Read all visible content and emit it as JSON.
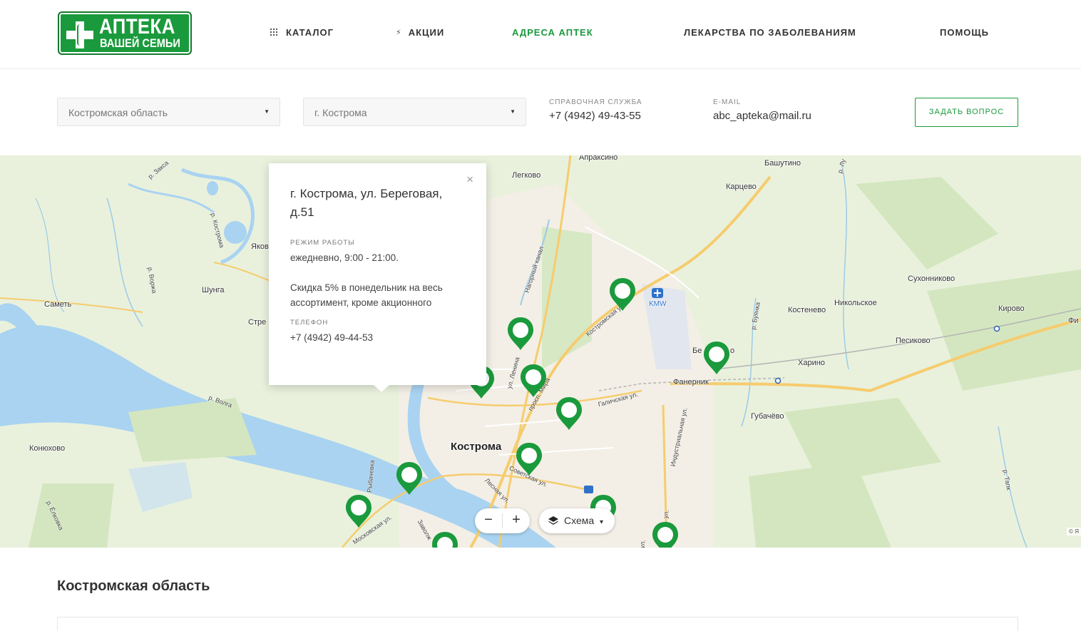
{
  "logo": {
    "line1": "АПТЕКА",
    "line2": "ВАШЕЙ СЕМЬИ",
    "brand_color": "#1a9a3c"
  },
  "nav": {
    "catalog": "КАТАЛОГ",
    "promo": "АКЦИИ",
    "addresses": "АДРЕСА АПТЕК",
    "diseases": "ЛЕКАРСТВА ПО ЗАБОЛЕВАНИЯМ",
    "help": "ПОМОЩЬ"
  },
  "filters": {
    "region": "Костромская область",
    "city": "г. Кострома"
  },
  "contacts": {
    "phone_label": "СПРАВОЧНАЯ СЛУЖБА",
    "phone": "+7 (4942) 49-43-55",
    "email_label": "E-MAIL",
    "email": "abc_apteka@mail.ru",
    "ask_button": "ЗАДАТЬ ВОПРОС"
  },
  "map": {
    "places": {
      "apraksino": "Апраксино",
      "bashutino": "Башутино",
      "legkovo": "Легково",
      "kartsevo": "Карцево",
      "yakov": "Яков",
      "shunga": "Шунга",
      "sametj": "Саметь",
      "stre": "Стре",
      "sukonnikovo": "Сухонниково",
      "kostenevo": "Костенево",
      "nikolskoe": "Никольское",
      "kirovo": "Кирово",
      "fi": "Фи",
      "pesikovo": "Песиково",
      "kharino": "Харино",
      "be": "Бе",
      "ro": "о",
      "fanernik": "Фанерник",
      "gubachevo": "Губачёво",
      "konyukhovo": "Конюхово",
      "kostroma": "Кострома",
      "kmw": "KMW"
    },
    "streets": {
      "zaksa": "р. Закса",
      "kostroma_r": "р. Кострома",
      "vorzha": "р. Воржа",
      "volga": "р. Волга",
      "nagorny": "Нагорный канал",
      "kostromskaya": "Костромская ул.",
      "lenina": "ул. Ленина",
      "mira": "просп. Мира",
      "galichskaya": "Галичская ул.",
      "industrialnaya": "Индустриальная ул.",
      "buyanka": "р. Буянка",
      "sovetskaya": "Советская ул.",
      "lesnaya": "Лесная ул.",
      "moskovskaya": "Московская ул.",
      "zavolzh": "Заволж",
      "elkovka": "р. Ёлковка",
      "lucha": "р. Лу",
      "tapk": "р. Тапк",
      "ul": "ул.",
      "ul2": "ул.",
      "ryb": "Рыбачевка"
    },
    "popup": {
      "address": "г. Кострома, ул. Береговая, д.51",
      "hours_label": "РЕЖИМ РАБОТЫ",
      "hours": "ежедневно, 9:00 - 21:00.",
      "note": "Скидка 5% в понедельник на весь ассортимент, кроме акционного",
      "phone_label": "ТЕЛЕФОН",
      "phone": "+7 (4942) 49-44-53",
      "close": "×"
    },
    "zoom_out": "−",
    "zoom_in": "+",
    "layer_label": "Схема",
    "layer_caret": "▾",
    "copyright": "© Я"
  },
  "section_title": "Костромская область"
}
